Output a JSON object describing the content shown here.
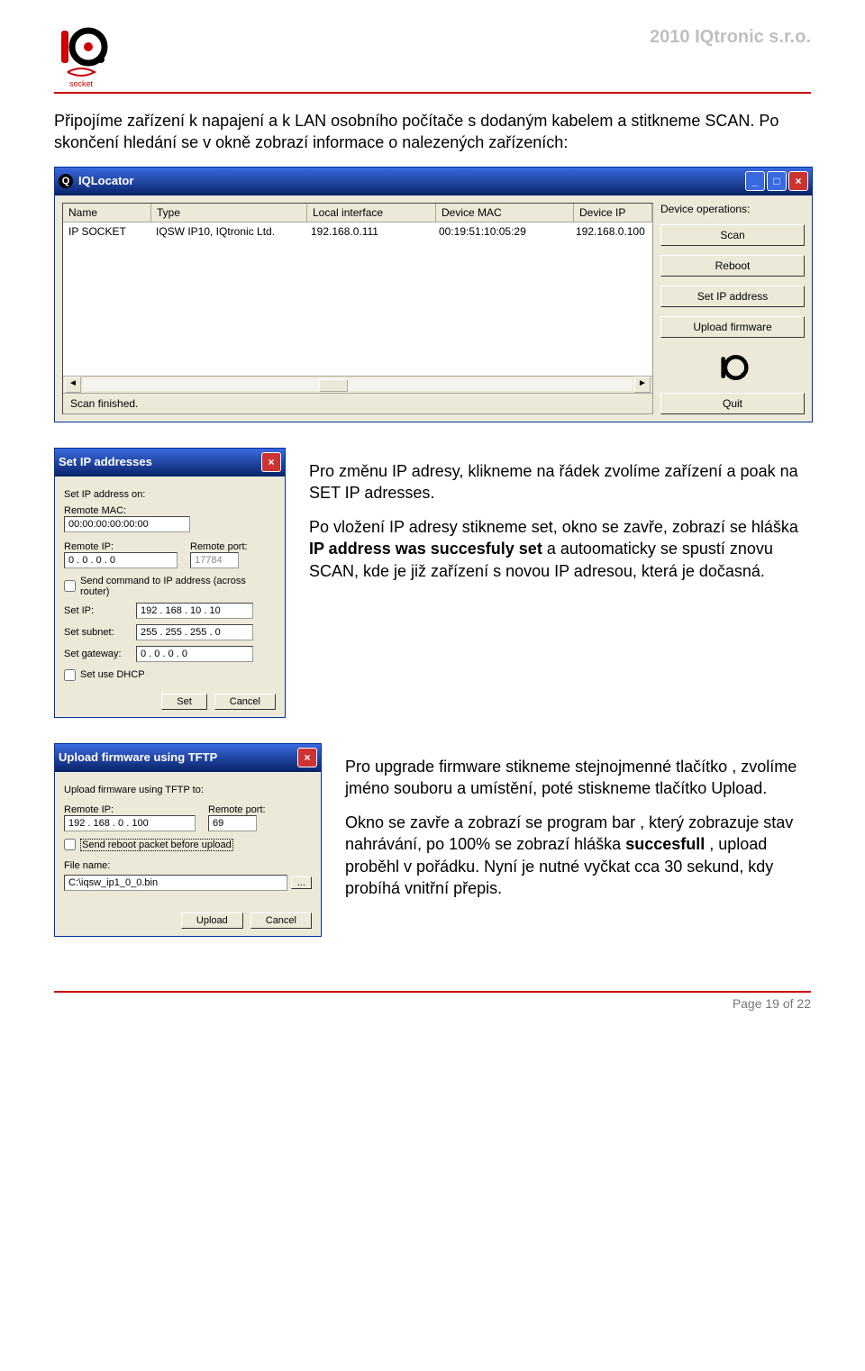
{
  "header": {
    "brand": "2010 IQtronic  s.r.o.",
    "logo_text": "socket"
  },
  "intro": "Připojíme zařízení k napajení a k LAN osobního počítače s dodaným kabelem a stitkneme SCAN. Po skončení hledání se v okně zobrazí informace o nalezených zařízeních:",
  "iqlocator": {
    "title": "IQLocator",
    "columns": {
      "name": "Name",
      "type": "Type",
      "local": "Local interface",
      "mac": "Device MAC",
      "ip": "Device IP"
    },
    "row": {
      "name": "IP SOCKET",
      "type": "IQSW IP10, IQtronic Ltd.",
      "local": "192.168.0.111",
      "mac": "00:19:51:10:05:29",
      "ip": "192.168.0.100"
    },
    "status": "Scan finished.",
    "ops_label": "Device operations:",
    "buttons": {
      "scan": "Scan",
      "reboot": "Reboot",
      "set_ip": "Set IP address",
      "upload_fw": "Upload firmware",
      "quit": "Quit"
    }
  },
  "set_ip_dialog": {
    "title": "Set IP addresses",
    "set_on": "Set IP address on:",
    "remote_mac_label": "Remote MAC:",
    "remote_mac": "00:00:00:00:00:00",
    "remote_ip_label": "Remote IP:",
    "remote_ip": "0   .   0   .   0   .   0",
    "remote_port_label": "Remote port:",
    "remote_port": "17784",
    "send_across_router": "Send command to IP address (across router)",
    "set_ip_label": "Set IP:",
    "set_ip": "192 . 168 .  10  .  10",
    "set_subnet_label": "Set subnet:",
    "set_subnet": "255 . 255 . 255 .   0",
    "set_gateway_label": "Set gateway:",
    "set_gateway": "0   .   0   .   0   .   0",
    "dhcp": "Set use DHCP",
    "btn_set": "Set",
    "btn_cancel": "Cancel"
  },
  "set_ip_text_1": "Pro změnu IP adresy, klikneme na řádek zvolíme zařízení a poak na SET IP adresses.",
  "set_ip_text_2a": "Po vložení IP adresy stikneme set, okno se zavře, zobrazí se hláška ",
  "set_ip_text_2b": "IP address was succesfuly set",
  "set_ip_text_2c": "  a autoomaticky se spustí znovu SCAN, kde je již zařízení s novou IP adresou, která je dočasná.",
  "upload_dialog": {
    "title": "Upload firmware using TFTP",
    "to_label": "Upload firmware using TFTP to:",
    "remote_ip_label": "Remote IP:",
    "remote_ip": "192 . 168 .   0   . 100",
    "remote_port_label": "Remote port:",
    "remote_port": "69",
    "reboot_first": "Send reboot packet before upload",
    "file_label": "File name:",
    "file_name": "C:\\iqsw_ip1_0_0.bin",
    "btn_upload": "Upload",
    "btn_cancel": "Cancel"
  },
  "upload_text_1": "Pro upgrade firmware stikneme stejnojmenné tlačítko , zvolíme jméno souboru a umístění, poté stiskneme tlačítko Upload.",
  "upload_text_2a": "Okno se zavře a zobrazí se program bar , který zobrazuje stav nahrávání, po 100% se zobrazí hláška ",
  "upload_text_2b": "succesfull",
  "upload_text_2c": "   , upload proběhl v pořádku. Nyní je nutné vyčkat cca 30 sekund, kdy probíhá vnitřní přepis.",
  "footer": "Page 19 of 22"
}
